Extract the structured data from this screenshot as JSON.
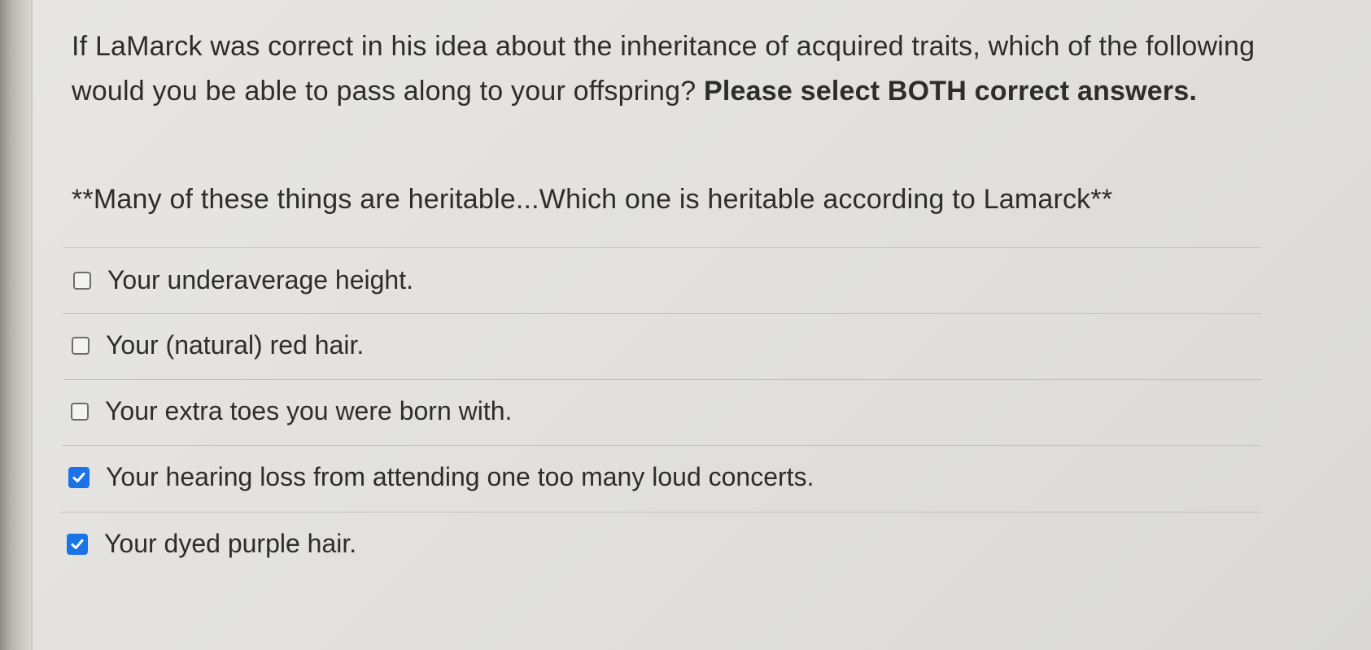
{
  "question": {
    "text_part1": "If LaMarck was correct in his idea about the inheritance of acquired traits, which of the following would you be able to pass along to your offspring?",
    "text_bold": "Please select BOTH correct answers."
  },
  "note": "**Many of these things are heritable...Which one is heritable according to Lamarck**",
  "answers": [
    {
      "label": "Your underaverage height.",
      "checked": false
    },
    {
      "label": "Your (natural) red hair.",
      "checked": false
    },
    {
      "label": "Your extra toes you were born with.",
      "checked": false
    },
    {
      "label": "Your hearing loss from attending one too many loud concerts.",
      "checked": true
    },
    {
      "label": "Your dyed purple hair.",
      "checked": true
    }
  ],
  "colors": {
    "checkbox_checked": "#1b73e8",
    "text": "#2d2d2d",
    "background": "#e4e3df"
  },
  "icons": {
    "unchecked": "checkbox-unchecked-icon",
    "checked": "checkmark-icon"
  }
}
